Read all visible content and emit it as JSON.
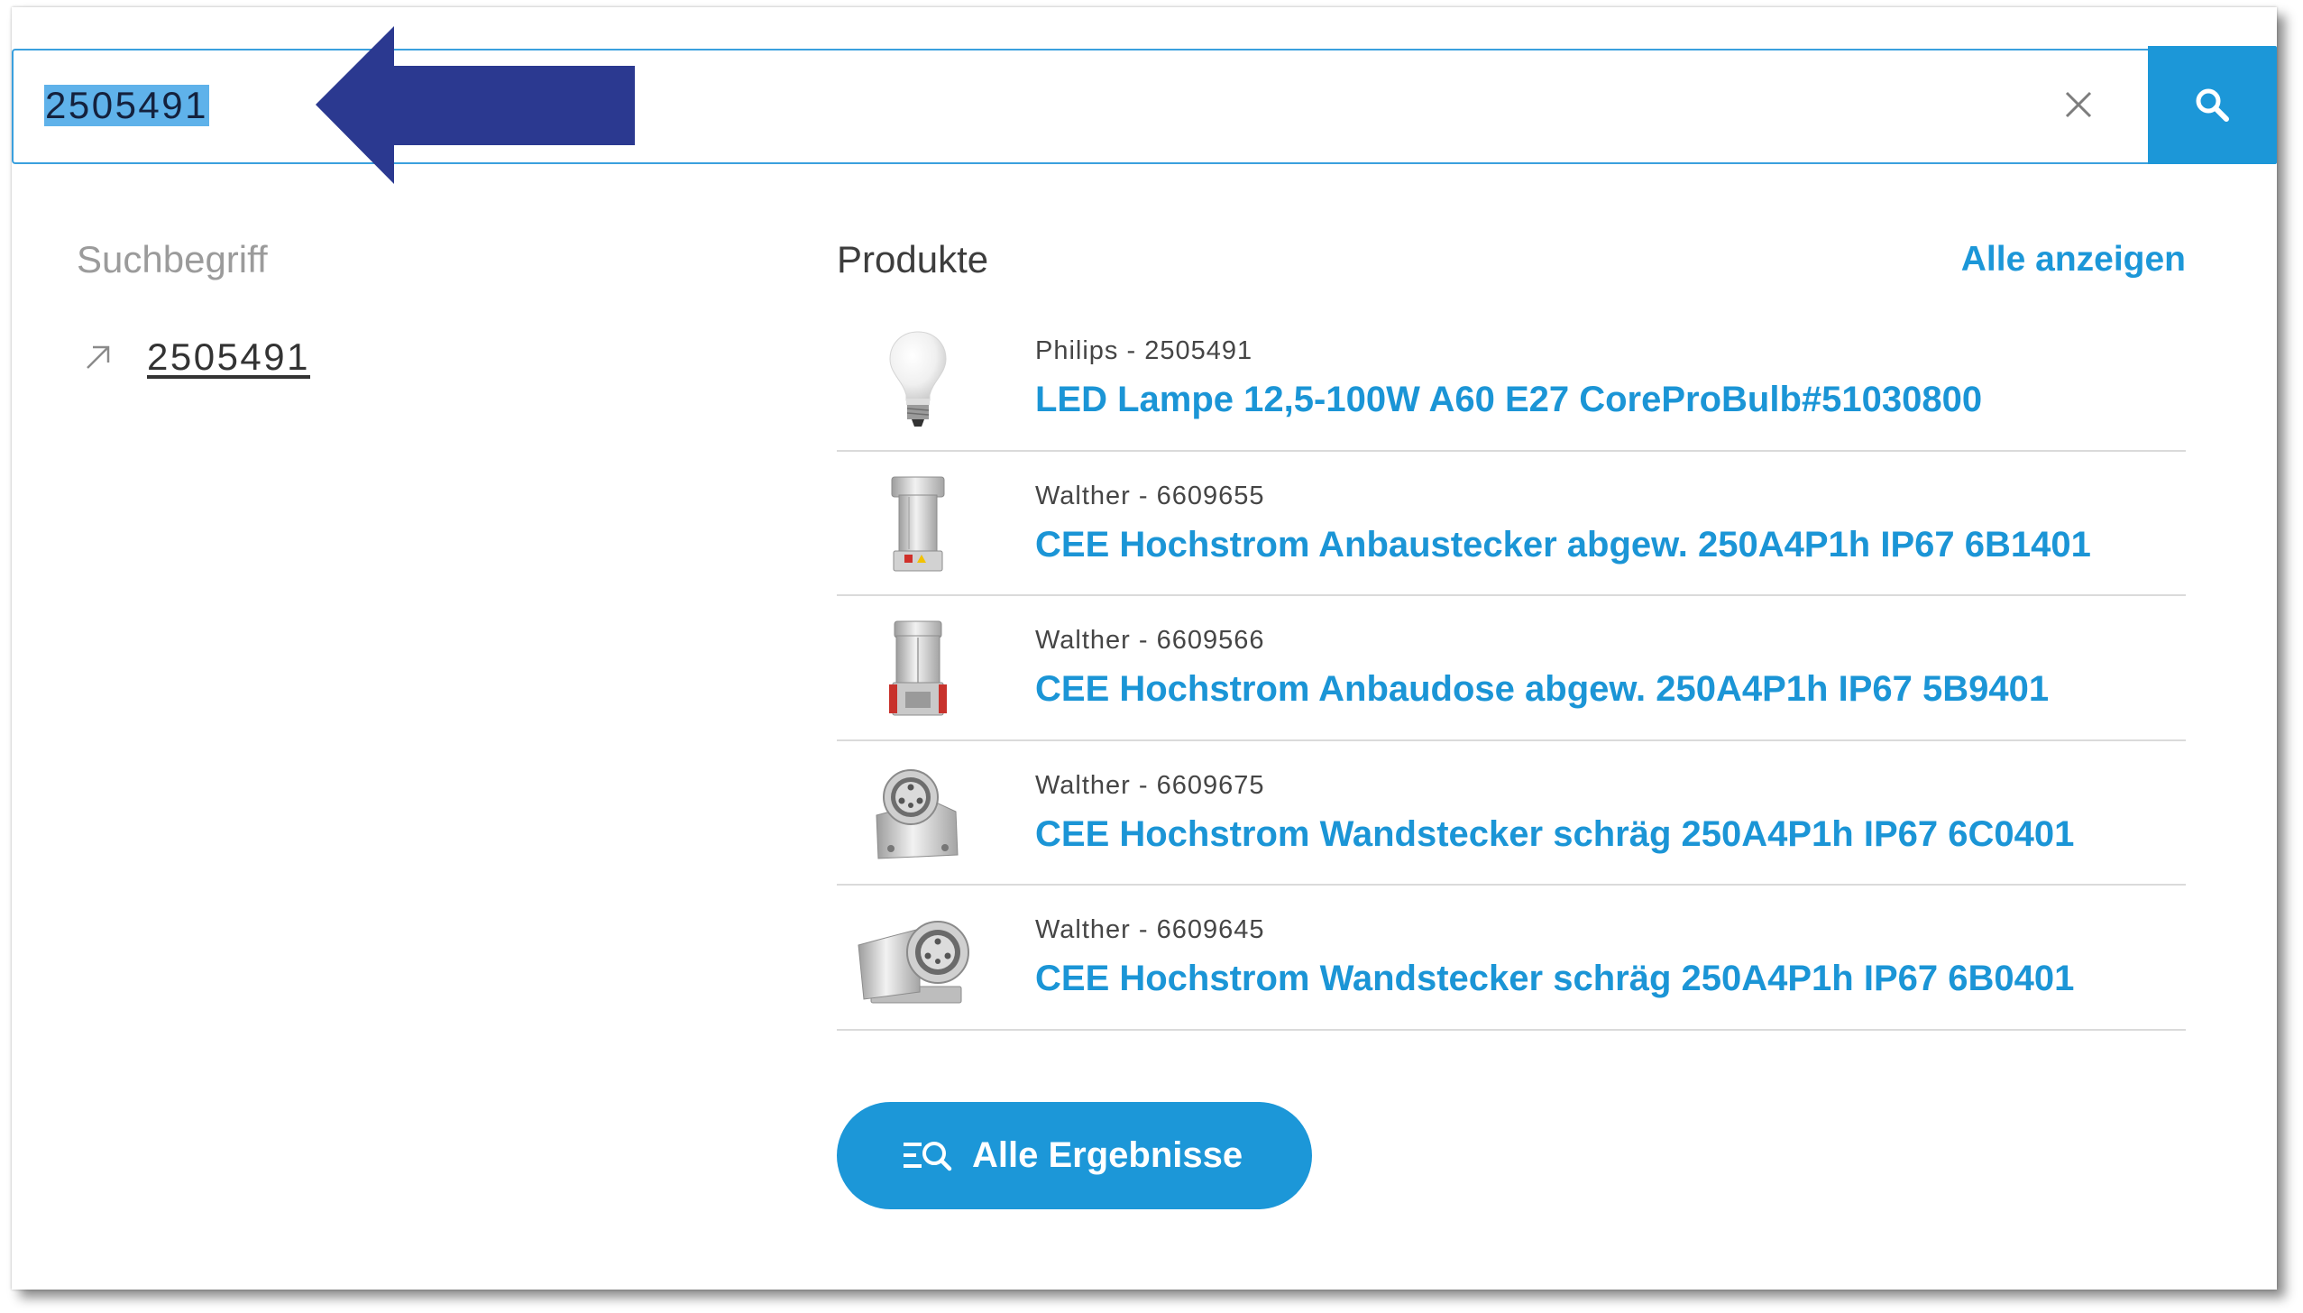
{
  "colors": {
    "accent": "#1c97d8",
    "title_link": "#1b95d6",
    "annotation_arrow": "#2b3990",
    "selection_highlight": "#5fb2ea",
    "separator": "#dadada"
  },
  "search": {
    "query": "2505491",
    "query_selected": true,
    "clear_icon": "close-icon",
    "submit_icon": "search-icon"
  },
  "annotation": {
    "icon": "left-arrow-annotation"
  },
  "suggestions": {
    "heading": "Suchbegriff",
    "items": [
      {
        "label": "2505491",
        "icon": "arrow-up-right-icon"
      }
    ]
  },
  "products": {
    "heading": "Produkte",
    "show_all_label": "Alle anzeigen",
    "items": [
      {
        "meta": "Philips - 2505491",
        "title": "LED Lampe 12,5-100W A60 E27 CoreProBulb#51030800",
        "image": "led-bulb"
      },
      {
        "meta": "Walther - 6609655",
        "title": "CEE Hochstrom Anbaustecker abgew. 250A4P1h IP67 6B1401",
        "image": "cee-panel-plug"
      },
      {
        "meta": "Walther - 6609566",
        "title": "CEE Hochstrom Anbaudose abgew. 250A4P1h IP67 5B9401",
        "image": "cee-panel-socket"
      },
      {
        "meta": "Walther - 6609675",
        "title": "CEE Hochstrom Wandstecker schräg 250A4P1h IP67 6C0401",
        "image": "cee-wall-plug-angled"
      },
      {
        "meta": "Walther - 6609645",
        "title": "CEE Hochstrom Wandstecker schräg 250A4P1h IP67 6B0401",
        "image": "cee-wall-plug-angled"
      }
    ]
  },
  "all_results_button": {
    "label": "Alle Ergebnisse",
    "icon": "search-list-icon"
  }
}
